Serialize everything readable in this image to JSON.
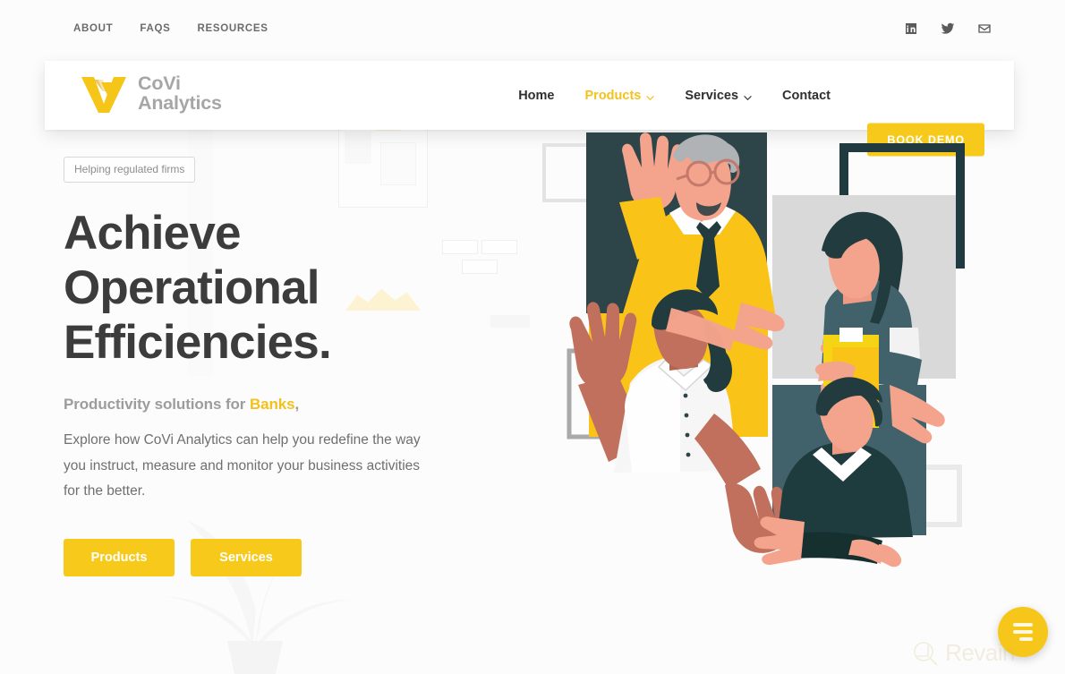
{
  "site": {
    "background_color": "#fcfcfc",
    "accent_color": "#f7c91b",
    "heading_color": "#3c3c3c"
  },
  "utility_bar": {
    "links": [
      {
        "label": "ABOUT"
      },
      {
        "label": "FAQS"
      },
      {
        "label": "RESOURCES"
      }
    ],
    "socials": [
      {
        "name": "linkedin-icon"
      },
      {
        "name": "twitter-icon"
      },
      {
        "name": "email-icon"
      }
    ]
  },
  "header": {
    "brand": {
      "line1": "CoVi",
      "line2": "Analytics",
      "logo_color": "#f2c21c",
      "text_color": "#a6a6a6"
    },
    "nav": [
      {
        "label": "Home",
        "has_dropdown": false,
        "active": false
      },
      {
        "label": "Products",
        "has_dropdown": true,
        "active": true
      },
      {
        "label": "Services",
        "has_dropdown": true,
        "active": false
      },
      {
        "label": "Contact",
        "has_dropdown": false,
        "active": false
      }
    ],
    "cta_label": "BOOK DEMO"
  },
  "hero": {
    "eyebrow": "Helping regulated firms",
    "headline_line1": "Achieve",
    "headline_line2": "Operational",
    "headline_line3": "Efficiencies.",
    "lead_prefix": "Productivity solutions for ",
    "lead_highlight": "Banks",
    "lead_suffix": ",",
    "body": "Explore how CoVi Analytics can help you redefine the way you instruct, measure and monitor your business activities for the better.",
    "buttons": [
      {
        "label": "Products"
      },
      {
        "label": "Services"
      }
    ]
  },
  "illustration": {
    "name": "team-video-call-illustration",
    "palette": {
      "dark_teal": "#2d4449",
      "slate_teal": "#41626b",
      "yellow": "#f9c318",
      "gray_panel": "#d9d9d9",
      "skin_light": "#f4a38c",
      "skin_deep": "#c0705c",
      "white": "#ffffff"
    }
  },
  "floating": {
    "chat_label": "chat-widget"
  },
  "watermark": {
    "text": "Revain"
  }
}
